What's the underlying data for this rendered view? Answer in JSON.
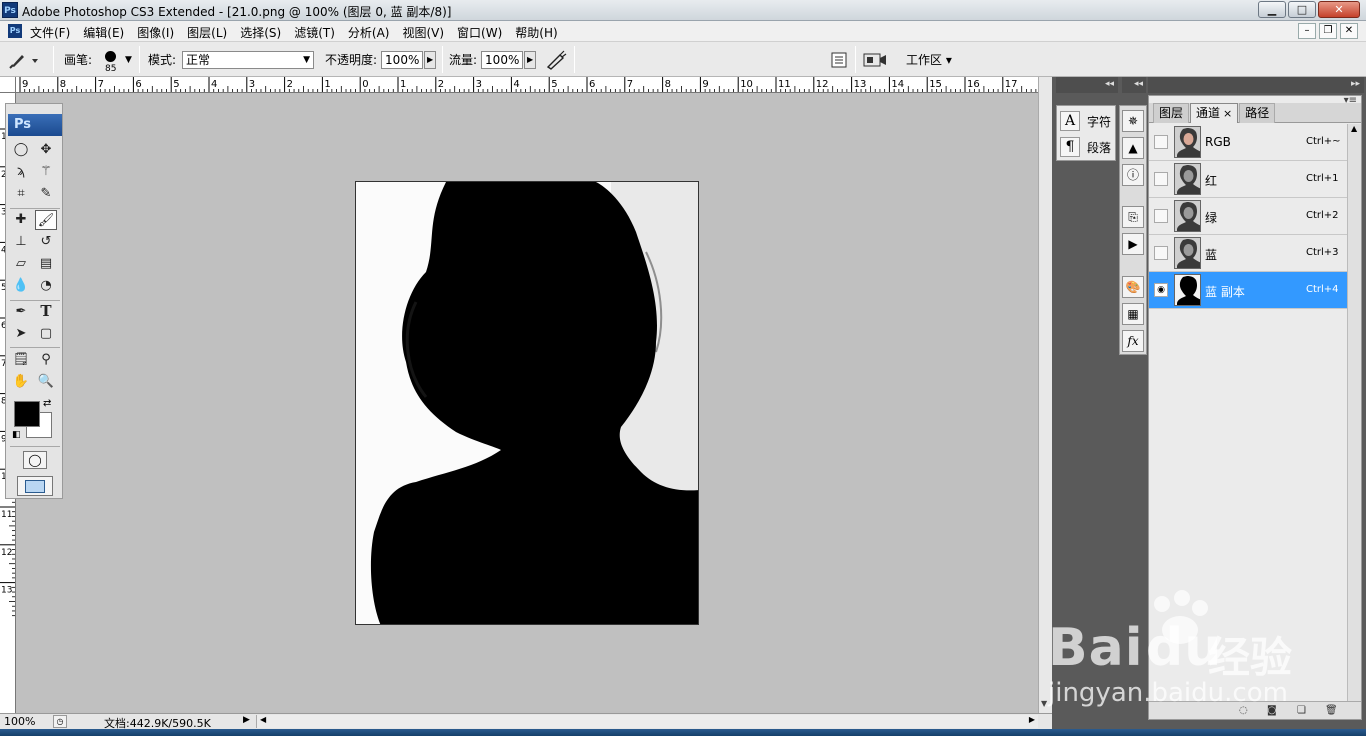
{
  "window": {
    "title": "Adobe Photoshop CS3 Extended - [21.0.png @ 100% (图层 0, 蓝 副本/8)]",
    "app_icon": "Ps",
    "minimize_icon": "minimize-icon",
    "maximize_icon": "maximize-icon",
    "close_icon": "close-icon"
  },
  "menubar": {
    "app_icon": "Ps",
    "items": [
      "文件(F)",
      "编辑(E)",
      "图像(I)",
      "图层(L)",
      "选择(S)",
      "滤镜(T)",
      "分析(A)",
      "视图(V)",
      "窗口(W)",
      "帮助(H)"
    ]
  },
  "options": {
    "brush_label": "画笔:",
    "brush_size": "85",
    "mode_label": "模式:",
    "mode_value": "正常",
    "opacity_label": "不透明度:",
    "opacity_value": "100%",
    "flow_label": "流量:",
    "flow_value": "100%",
    "workspace_label": "工作区 ▾"
  },
  "ruler": {
    "h_labels": [
      "9",
      "8",
      "7",
      "6",
      "5",
      "4",
      "3",
      "2",
      "1",
      "0",
      "1",
      "2",
      "3",
      "4",
      "5",
      "6",
      "7",
      "8",
      "9",
      "10",
      "11",
      "12",
      "13",
      "14",
      "15",
      "16",
      "17"
    ],
    "v_labels": [
      "1",
      "2",
      "3",
      "4",
      "5",
      "6",
      "7",
      "8",
      "9",
      "10",
      "11",
      "12",
      "13"
    ]
  },
  "toolbox": {
    "logo": "Ps"
  },
  "dock": {
    "character_label": "字符",
    "paragraph_label": "段落"
  },
  "channels_panel": {
    "tabs": [
      {
        "label": "图层",
        "active": false
      },
      {
        "label": "通道",
        "active": true
      },
      {
        "label": "路径",
        "active": false
      }
    ],
    "tab_close": "×",
    "rows": [
      {
        "name": "RGB",
        "shortcut": "Ctrl+~",
        "selected": false,
        "visible": false
      },
      {
        "name": "红",
        "shortcut": "Ctrl+1",
        "selected": false,
        "visible": false
      },
      {
        "name": "绿",
        "shortcut": "Ctrl+2",
        "selected": false,
        "visible": false
      },
      {
        "name": "蓝",
        "shortcut": "Ctrl+3",
        "selected": false,
        "visible": false
      },
      {
        "name": "蓝 副本",
        "shortcut": "Ctrl+4",
        "selected": true,
        "visible": true
      }
    ]
  },
  "status": {
    "zoom": "100%",
    "doc_info": "文档:442.9K/590.5K"
  },
  "watermark": {
    "brand": "Bai",
    "brand_tail": "du",
    "brand_cn": "经验",
    "url": "jingyan.baidu.com"
  },
  "colors": {
    "selection_blue": "#3399ff",
    "foreground": "#000000",
    "background": "#ffffff",
    "workspace": "#c0c0c0",
    "dock": "#5a5a5a"
  }
}
